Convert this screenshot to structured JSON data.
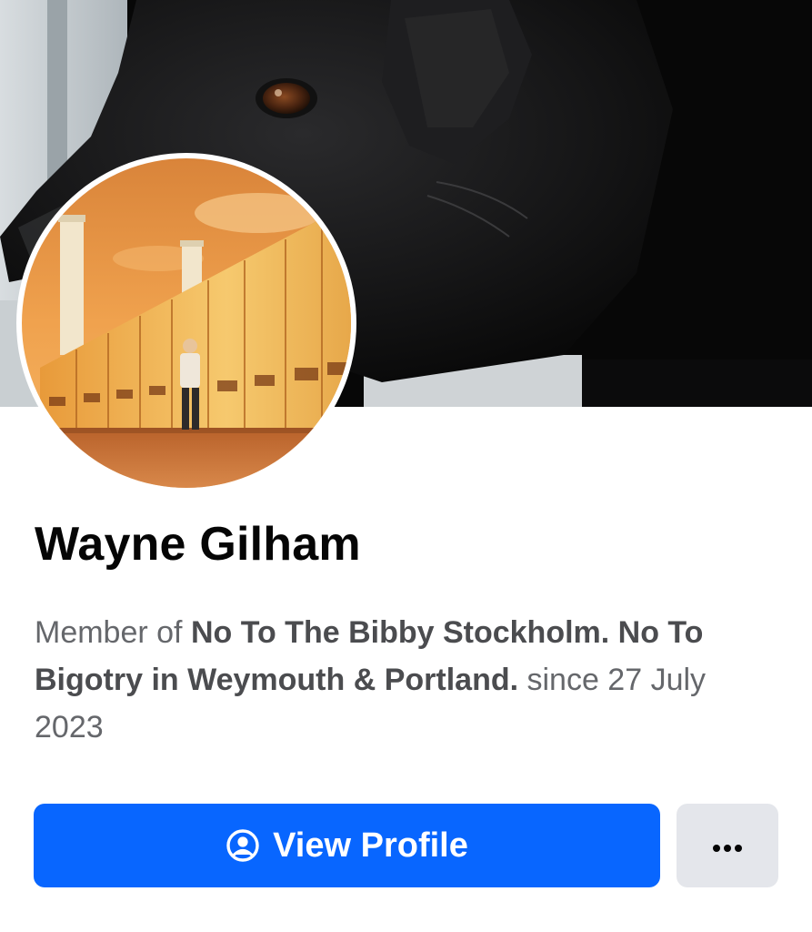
{
  "profile": {
    "name": "Wayne Gilham",
    "membership": {
      "prefix": "Member of ",
      "group_name": "No To The Bibby Stockholm. No To Bigotry in Weymouth & Portland.",
      "since_text": " since 27 July 2023"
    }
  },
  "actions": {
    "view_profile_label": "View Profile",
    "view_profile_icon": "user-circle-icon",
    "more_icon": "more-dots-icon"
  },
  "images": {
    "cover_photo": "black-dog-closeup",
    "profile_photo": "man-in-front-of-lit-wall-with-chimneys"
  },
  "colors": {
    "primary_button": "#0866ff",
    "secondary_button": "#e4e6eb",
    "name_text": "#050505",
    "secondary_text": "#65676b"
  }
}
